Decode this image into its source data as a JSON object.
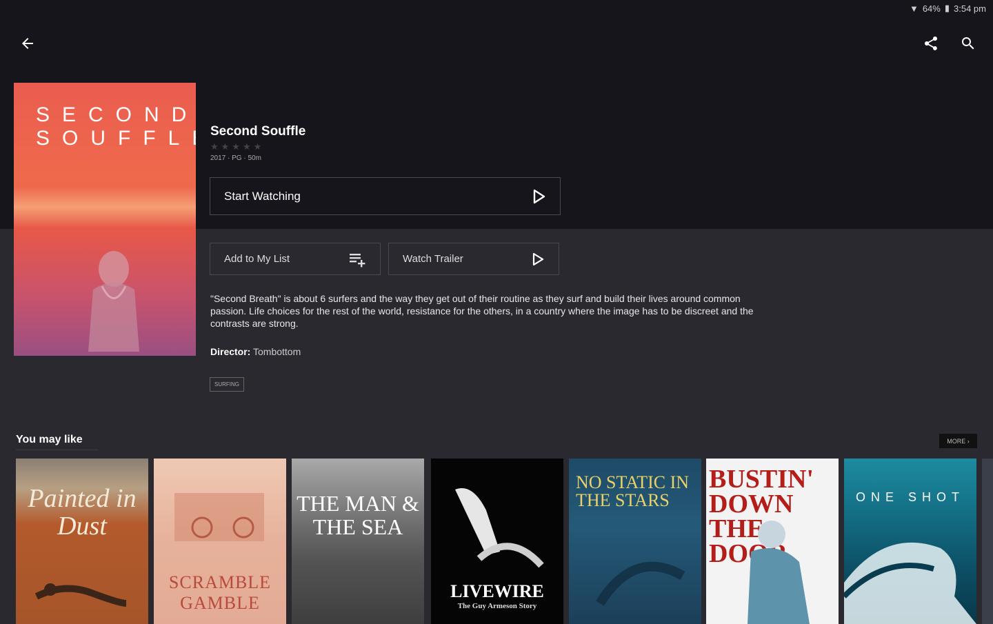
{
  "status": {
    "battery": "64%",
    "time": "3:54 pm"
  },
  "icons": {
    "back": "arrow-left-icon",
    "share": "share-icon",
    "search": "search-icon"
  },
  "movie": {
    "title": "Second Souffle",
    "poster_lines": [
      "SECOND",
      "SOUFFLE"
    ],
    "rating_stars": "★★★★★",
    "meta": "2017 · PG · 50m",
    "start_label": "Start Watching",
    "add_list_label": "Add to My List",
    "trailer_label": "Watch Trailer",
    "description": "\"Second Breath\" is about 6 surfers and the way they get out of their routine as they surf and build their lives around common passion. Life choices for the rest of the world, resistance for the others, in a country where the image has to be discreet and the contrasts are strong.",
    "director_label": "Director:",
    "director": "Tombottom",
    "tag": "SURFING"
  },
  "recommendations": {
    "title": "You may like",
    "more_label": "MORE ›",
    "items": [
      {
        "title": "Painted in Dust"
      },
      {
        "title": "SCRAMBLE GAMBLE"
      },
      {
        "title": "THE MAN & THE SEA"
      },
      {
        "title": "LIVEWIRE",
        "subtitle": "The Guy Armeson Story"
      },
      {
        "title": "NO STATIC IN THE STARS"
      },
      {
        "title": "BUSTIN' DOWN THE DOOR"
      },
      {
        "title": "ONE SHOT"
      }
    ]
  },
  "colors": {
    "background": "#2a2930",
    "header": "#16151b",
    "poster_accent": "#ea5c4f"
  }
}
